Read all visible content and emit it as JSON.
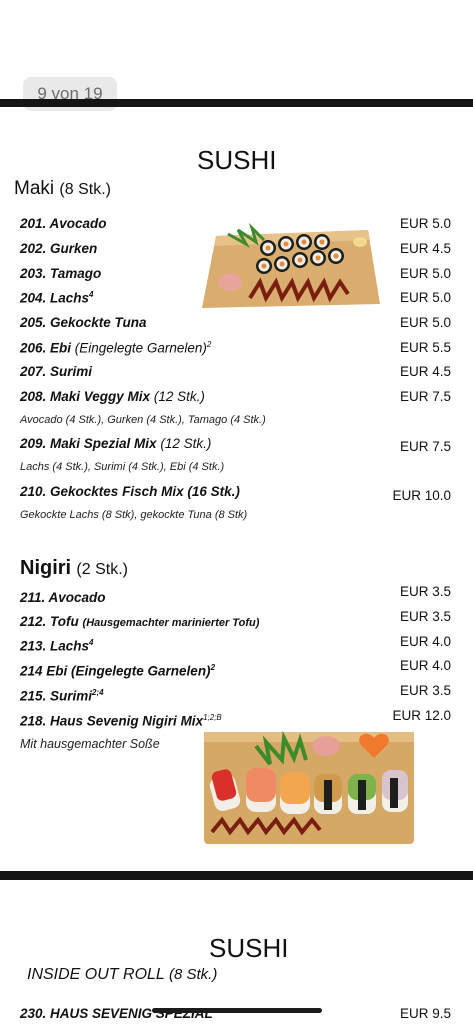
{
  "page_indicator": "9 von 19",
  "colors": {
    "rule": "#141414",
    "badge_bg": "#e9e9ea",
    "board": "#d9ad6d",
    "sauce": "#7a1e12"
  },
  "page1": {
    "title": "SUSHI",
    "maki": {
      "name": "Maki",
      "qty": "(8 Stk.)",
      "items": [
        {
          "label": "201. Avocado",
          "price": "EUR 5.0"
        },
        {
          "label": "202. Gurken",
          "price": "EUR 4.5"
        },
        {
          "label": "203. Tamago",
          "price": "EUR 5.0"
        },
        {
          "label": "204. Lachs",
          "sup": "4",
          "price": "EUR 5.0"
        },
        {
          "label": "205. Gekockte Tuna",
          "price": "EUR 5.0"
        },
        {
          "label": "206. Ebi",
          "note": "(Eingelegte Garnelen)",
          "sup": "2",
          "price": "EUR 5.5"
        },
        {
          "label": "207. Surimi",
          "price": "EUR 4.5"
        },
        {
          "label": "208. Maki Veggy Mix",
          "note": "(12 Stk.)",
          "price": "EUR 7.5",
          "sub": "Avocado (4 Stk.), Gurken (4 Stk.), Tamago (4 Stk.)"
        },
        {
          "label": "209. Maki Spezial Mix",
          "note": "(12 Stk.)",
          "price": "EUR 7.5",
          "sub": "Lachs (4 Stk.), Surimi (4 Stk.), Ebi (4 Stk.)"
        },
        {
          "label": "210. Gekocktes Fisch Mix (16 Stk.)",
          "price": "EUR 10.0",
          "sub": "Gekockte Lachs (8 Stk), gekockte Tuna (8 Stk)"
        }
      ]
    },
    "nigiri": {
      "name": "Nigiri",
      "qty": "(2 Stk.)",
      "items": [
        {
          "label": "211. Avocado",
          "price": "EUR 3.5"
        },
        {
          "label": "212. Tofu",
          "note": "(Hausgemachter marinierter Tofu)",
          "price": "EUR 3.5"
        },
        {
          "label": "213. Lachs",
          "sup": "4",
          "price": "EUR 4.0"
        },
        {
          "label": "214 Ebi (Eingelegte Garnelen)",
          "sup": "2",
          "price": "EUR 4.0"
        },
        {
          "label": "215. Surimi",
          "sup": "2;4",
          "price": "EUR 3.5"
        },
        {
          "label": "218. Haus Sevenig Nigiri Mix",
          "sup": "1;2;B",
          "price": "EUR 12.0",
          "sub": "Mit hausgemachter Soße"
        }
      ]
    }
  },
  "page2": {
    "title": "SUSHI",
    "section": "INSIDE OUT ROLL",
    "section_qty": "(8 Stk.)",
    "items": [
      {
        "label": "230. HAUS SEVENIG SPEZIAL",
        "price": "EUR 9.5"
      }
    ]
  }
}
